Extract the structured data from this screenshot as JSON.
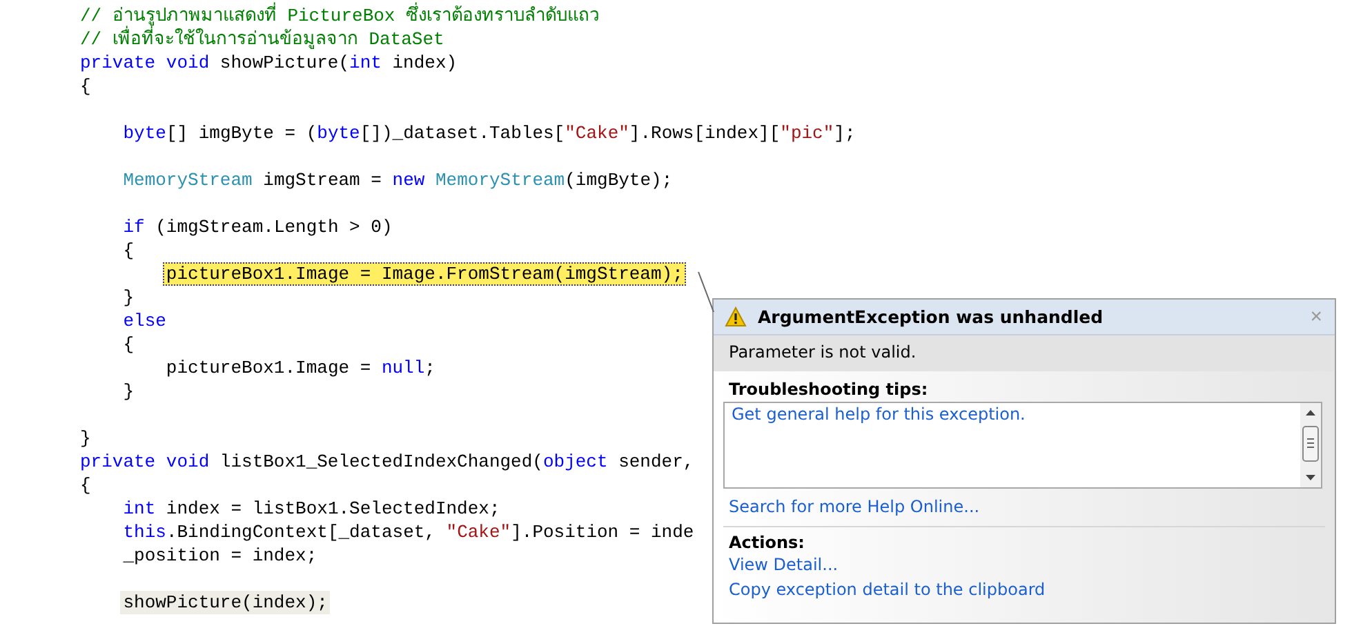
{
  "code_lines": [
    {
      "kind": "code",
      "current_statement": false,
      "call_site": false,
      "tokens": [
        {
          "kind": "comment",
          "text": "// อ่านรูปภาพมาแสดงที่ PictureBox ซึ่งเราต้องทราบลำดับแถว"
        }
      ]
    },
    {
      "kind": "code",
      "current_statement": false,
      "call_site": false,
      "tokens": [
        {
          "kind": "comment",
          "text": "// เพื่อที่จะใช้ในการอ่านข้อมูลจาก DataSet"
        }
      ]
    },
    {
      "kind": "code",
      "current_statement": false,
      "call_site": false,
      "tokens": [
        {
          "kind": "keyword",
          "text": "private void "
        },
        {
          "kind": "plain",
          "text": "showPicture("
        },
        {
          "kind": "keyword",
          "text": "int"
        },
        {
          "kind": "plain",
          "text": " index)"
        }
      ]
    },
    {
      "kind": "code",
      "current_statement": false,
      "call_site": false,
      "tokens": [
        {
          "kind": "plain",
          "text": "{"
        }
      ]
    },
    {
      "kind": "blank"
    },
    {
      "kind": "code",
      "current_statement": false,
      "call_site": false,
      "tokens": [
        {
          "kind": "keyword",
          "text": "    byte"
        },
        {
          "kind": "plain",
          "text": "[] imgByte = ("
        },
        {
          "kind": "keyword",
          "text": "byte"
        },
        {
          "kind": "plain",
          "text": "[])_dataset.Tables["
        },
        {
          "kind": "string",
          "text": "\"Cake\""
        },
        {
          "kind": "plain",
          "text": "].Rows[index]["
        },
        {
          "kind": "string",
          "text": "\"pic\""
        },
        {
          "kind": "plain",
          "text": "];"
        }
      ]
    },
    {
      "kind": "blank"
    },
    {
      "kind": "code",
      "current_statement": false,
      "call_site": false,
      "tokens": [
        {
          "kind": "type",
          "text": "    MemoryStream"
        },
        {
          "kind": "plain",
          "text": " imgStream = "
        },
        {
          "kind": "keyword",
          "text": "new "
        },
        {
          "kind": "type",
          "text": "MemoryStream"
        },
        {
          "kind": "plain",
          "text": "(imgByte);"
        }
      ]
    },
    {
      "kind": "blank"
    },
    {
      "kind": "code",
      "current_statement": false,
      "call_site": false,
      "tokens": [
        {
          "kind": "keyword",
          "text": "    if"
        },
        {
          "kind": "plain",
          "text": " (imgStream.Length > 0)"
        }
      ]
    },
    {
      "kind": "code",
      "current_statement": false,
      "call_site": false,
      "tokens": [
        {
          "kind": "plain",
          "text": "    {"
        }
      ]
    },
    {
      "kind": "code",
      "current_statement": true,
      "call_site": false,
      "tokens": [
        {
          "kind": "plain",
          "text": "        pictureBox1.Image = Image.FromStream(imgStream);"
        }
      ]
    },
    {
      "kind": "code",
      "current_statement": false,
      "call_site": false,
      "tokens": [
        {
          "kind": "plain",
          "text": "    }"
        }
      ]
    },
    {
      "kind": "code",
      "current_statement": false,
      "call_site": false,
      "tokens": [
        {
          "kind": "keyword",
          "text": "    else"
        }
      ]
    },
    {
      "kind": "code",
      "current_statement": false,
      "call_site": false,
      "tokens": [
        {
          "kind": "plain",
          "text": "    {"
        }
      ]
    },
    {
      "kind": "code",
      "current_statement": false,
      "call_site": false,
      "tokens": [
        {
          "kind": "plain",
          "text": "        pictureBox1.Image = "
        },
        {
          "kind": "keyword",
          "text": "null"
        },
        {
          "kind": "plain",
          "text": ";"
        }
      ]
    },
    {
      "kind": "code",
      "current_statement": false,
      "call_site": false,
      "tokens": [
        {
          "kind": "plain",
          "text": "    }"
        }
      ]
    },
    {
      "kind": "blank"
    },
    {
      "kind": "code",
      "current_statement": false,
      "call_site": false,
      "tokens": [
        {
          "kind": "plain",
          "text": "}"
        }
      ]
    },
    {
      "kind": "code",
      "current_statement": false,
      "call_site": false,
      "tokens": [
        {
          "kind": "keyword",
          "text": "private void "
        },
        {
          "kind": "plain",
          "text": "listBox1_SelectedIndexChanged("
        },
        {
          "kind": "keyword",
          "text": "object"
        },
        {
          "kind": "plain",
          "text": " sender,"
        }
      ]
    },
    {
      "kind": "code",
      "current_statement": false,
      "call_site": false,
      "tokens": [
        {
          "kind": "plain",
          "text": "{"
        }
      ]
    },
    {
      "kind": "code",
      "current_statement": false,
      "call_site": false,
      "tokens": [
        {
          "kind": "keyword",
          "text": "    int"
        },
        {
          "kind": "plain",
          "text": " index = listBox1.SelectedIndex;"
        }
      ]
    },
    {
      "kind": "code",
      "current_statement": false,
      "call_site": false,
      "tokens": [
        {
          "kind": "keyword",
          "text": "    this"
        },
        {
          "kind": "plain",
          "text": ".BindingContext[_dataset, "
        },
        {
          "kind": "string",
          "text": "\"Cake\""
        },
        {
          "kind": "plain",
          "text": "].Position = inde"
        }
      ]
    },
    {
      "kind": "code",
      "current_statement": false,
      "call_site": false,
      "tokens": [
        {
          "kind": "plain",
          "text": "    _position = index;"
        }
      ]
    },
    {
      "kind": "blank"
    },
    {
      "kind": "code",
      "current_statement": false,
      "call_site": true,
      "tokens": [
        {
          "kind": "plain",
          "text": "    showPicture(index);"
        }
      ]
    }
  ],
  "exception_popup": {
    "title": "ArgumentException was unhandled",
    "close": "×",
    "message": "Parameter is not valid.",
    "tips_heading": "Troubleshooting tips:",
    "tips": [
      "Get general help for this exception."
    ],
    "search_link": "Search for more Help Online...",
    "actions_heading": "Actions:",
    "actions": [
      "View Detail...",
      "Copy exception detail to the clipboard"
    ]
  }
}
